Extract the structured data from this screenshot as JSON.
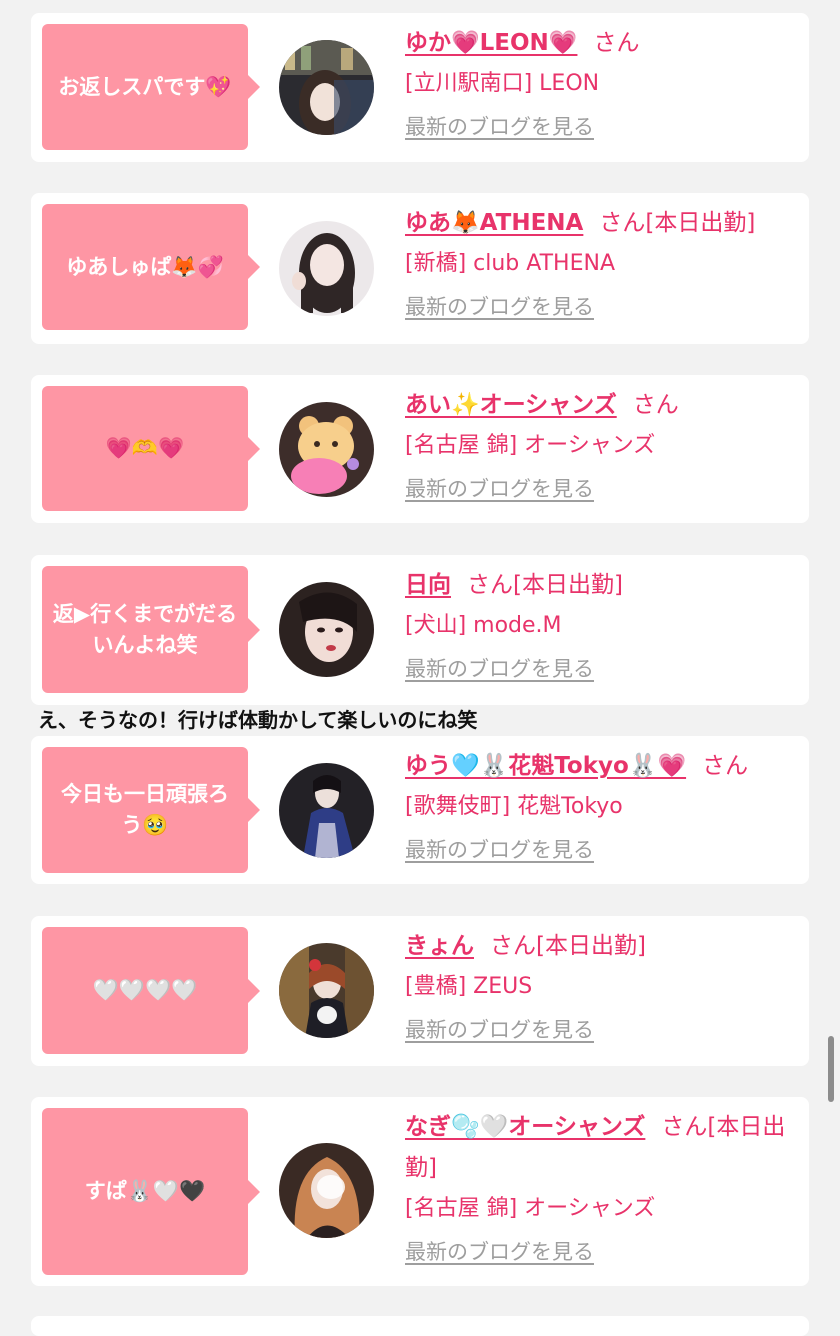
{
  "cards": [
    {
      "message": "お返しスパです💖",
      "name": "ゆか💗LEON💗",
      "suffix": "さん",
      "shop": "[立川駅南口] LEON",
      "blog_link": "最新のブログを見る"
    },
    {
      "message": "ゆあしゅぱ🦊💞",
      "name": "ゆあ🦊ATHENA",
      "suffix": "さん[本日出勤]",
      "shop": "[新橋] club ATHENA",
      "blog_link": "最新のブログを見る"
    },
    {
      "message": "💗🫶💗",
      "name": "あい✨オーシャンズ",
      "suffix": "さん",
      "shop": "[名古屋 錦] オーシャンズ",
      "blog_link": "最新のブログを見る"
    },
    {
      "message": "返▶行くまでがだるいんよね笑",
      "name": "日向",
      "suffix": "さん[本日出勤]",
      "shop": "[犬山] mode.M",
      "blog_link": "最新のブログを見る"
    },
    {
      "message": "今日も一日頑張ろう🥹",
      "name": "ゆう🩵🐰花魁Tokyo🐰💗",
      "suffix": "さん",
      "shop": "[歌舞伎町] 花魁Tokyo",
      "blog_link": "最新のブログを見る"
    },
    {
      "message": "🤍🤍🤍🤍",
      "name": "きょん",
      "suffix": "さん[本日出勤]",
      "shop": "[豊橋] ZEUS",
      "blog_link": "最新のブログを見る"
    },
    {
      "message": "すぱ🐰🤍🖤",
      "name": "なぎ🫧🤍オーシャンズ",
      "suffix": "さん[本日出勤]",
      "shop": "[名古屋 錦] オーシャンズ",
      "blog_link": "最新のブログを見る"
    }
  ],
  "overlay_comment": "え、そうなの！行けば体動かして楽しいのにね笑",
  "colors": {
    "bubble": "#fe96a4",
    "name": "#e8336a",
    "link_gray": "#9e9e9e",
    "background": "#f2f2f2"
  }
}
